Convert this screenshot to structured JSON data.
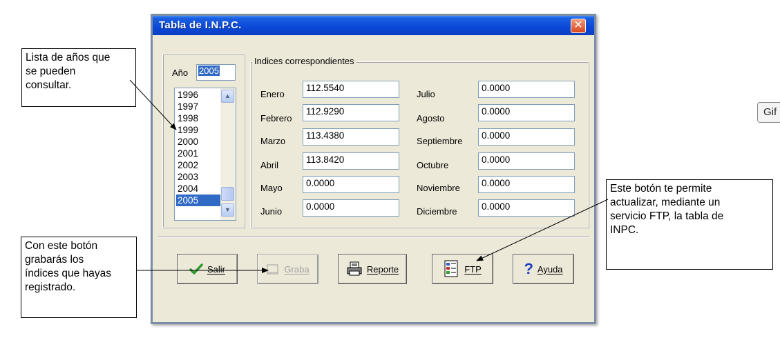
{
  "window": {
    "title": "Tabla de I.N.P.C.",
    "close_glyph": "✕"
  },
  "year_panel": {
    "label": "Año",
    "current_year": "2005",
    "years": [
      "1996",
      "1997",
      "1998",
      "1999",
      "2000",
      "2001",
      "2002",
      "2003",
      "2004",
      "2005"
    ],
    "selected": "2005"
  },
  "indices": {
    "legend": "Indices correspondientes",
    "months": [
      {
        "label": "Enero",
        "value": "112.5540"
      },
      {
        "label": "Febrero",
        "value": "112.9290"
      },
      {
        "label": "Marzo",
        "value": "113.4380"
      },
      {
        "label": "Abril",
        "value": "113.8420"
      },
      {
        "label": "Mayo",
        "value": "0.0000"
      },
      {
        "label": "Junio",
        "value": "0.0000"
      },
      {
        "label": "Julio",
        "value": "0.0000"
      },
      {
        "label": "Agosto",
        "value": "0.0000"
      },
      {
        "label": "Septiembre",
        "value": "0.0000"
      },
      {
        "label": "Octubre",
        "value": "0.0000"
      },
      {
        "label": "Noviembre",
        "value": "0.0000"
      },
      {
        "label": "Diciembre",
        "value": "0.0000"
      }
    ]
  },
  "buttons": {
    "salir": "Salir",
    "graba": "Graba",
    "reporte": "Reporte",
    "ftp": "FTP",
    "ayuda": "Ayuda"
  },
  "callouts": {
    "years": [
      "Lista de años que",
      "se pueden",
      "consultar."
    ],
    "graba": [
      "Con este botón",
      "grabarás los",
      "índices que hayas",
      "registrado."
    ],
    "ftp": [
      "Este botón te permite",
      "actualizar, mediante un",
      "servicio FTP, la tabla de",
      "INPC."
    ]
  },
  "gif_tab": "Gif",
  "colors": {
    "titlebar": "#0a48d8",
    "dialog_bg": "#ece9d8",
    "selection": "#316ac5",
    "close": "#d8451c"
  }
}
